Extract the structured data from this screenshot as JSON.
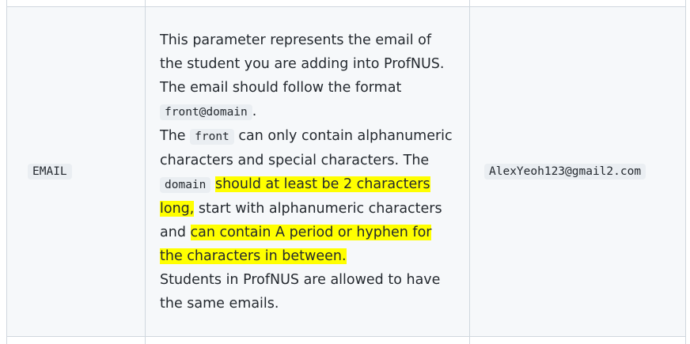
{
  "row": {
    "parameter": "EMAIL",
    "example": "AlexYeoh123@gmail2.com",
    "description": {
      "p1": "This parameter represents the email of the student you are adding into ProfNUS.",
      "p2_pre": "The email should follow the format",
      "p2_code": "front@domain",
      "p2_post": ".",
      "p3_a": "The",
      "p3_code1": "front",
      "p3_b": "can only contain alphanumeric characters and special characters. The",
      "p3_code2": "domain",
      "p3_hl1": "should at least be 2 characters long,",
      "p3_c": "start with alphanumeric characters and",
      "p3_hl2": "can contain A period or hyphen for the characters in between.",
      "p4": "Students in ProfNUS are allowed to have the same emails."
    }
  },
  "colors": {
    "highlight": "#ffff00",
    "row_background": "#f6f8fa",
    "border": "#d0d7de"
  }
}
